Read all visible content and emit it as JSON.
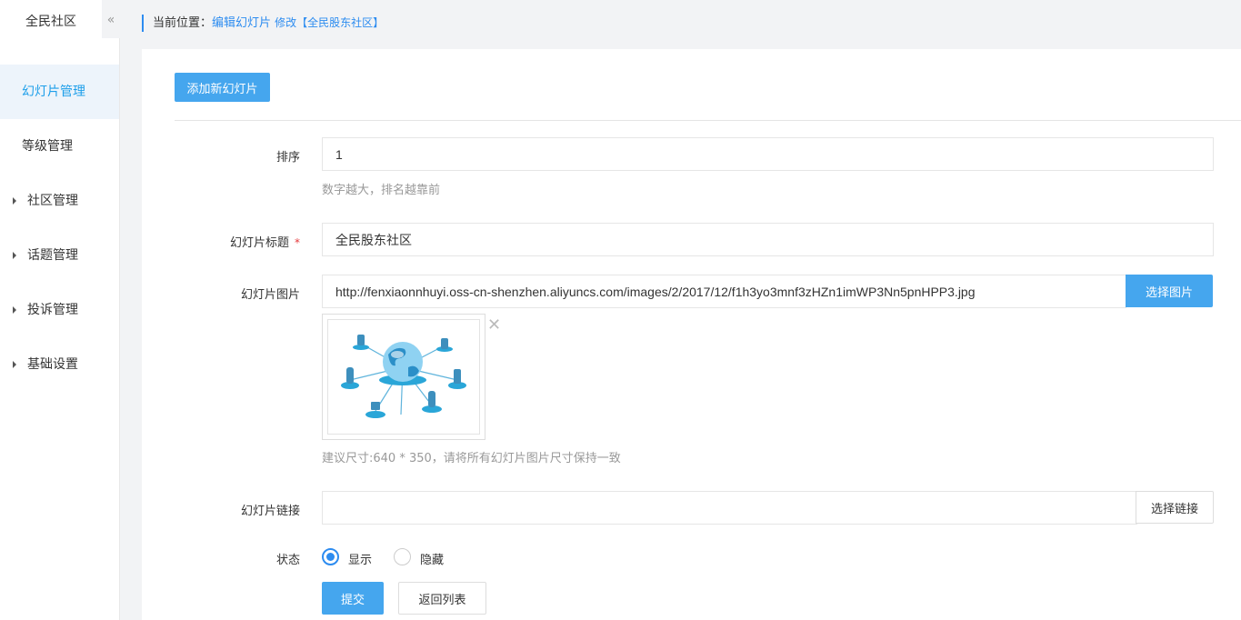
{
  "sidebar": {
    "brand": "全民社区",
    "collapse_icon": "«",
    "items": [
      {
        "label": "幻灯片管理",
        "active": true,
        "expandable": false
      },
      {
        "label": "等级管理",
        "active": false,
        "expandable": false
      },
      {
        "label": "社区管理",
        "active": false,
        "expandable": true
      },
      {
        "label": "话题管理",
        "active": false,
        "expandable": true
      },
      {
        "label": "投诉管理",
        "active": false,
        "expandable": true
      },
      {
        "label": "基础设置",
        "active": false,
        "expandable": true
      }
    ]
  },
  "breadcrumb": {
    "label": "当前位置：",
    "link": "编辑幻灯片",
    "extra": "修改【全民股东社区】"
  },
  "toolbar": {
    "add_label": "添加新幻灯片"
  },
  "form": {
    "sort": {
      "label": "排序",
      "value": "1",
      "help": "数字越大，排名越靠前"
    },
    "title": {
      "label": "幻灯片标题",
      "required_mark": "*",
      "value": "全民股东社区"
    },
    "image": {
      "label": "幻灯片图片",
      "value": "http://fenxiaonnhuyi.oss-cn-shenzhen.aliyuncs.com/images/2/2017/12/f1h3yo3mnf3zHZn1imWP3Nn5pnHPP3.jpg",
      "button": "选择图片",
      "remove_icon": "✕",
      "help": "建议尺寸:640 * 350，请将所有幻灯片图片尺寸保持一致"
    },
    "link": {
      "label": "幻灯片链接",
      "value": "",
      "button": "选择链接"
    },
    "status": {
      "label": "状态",
      "options": [
        "显示",
        "隐藏"
      ],
      "selected": "显示"
    },
    "submit": "提交",
    "back": "返回列表"
  },
  "colors": {
    "primary": "#45a6ee",
    "active_nav": "#1e9fea",
    "link": "#2d8cf0",
    "bg_gray": "#f2f3f5"
  }
}
